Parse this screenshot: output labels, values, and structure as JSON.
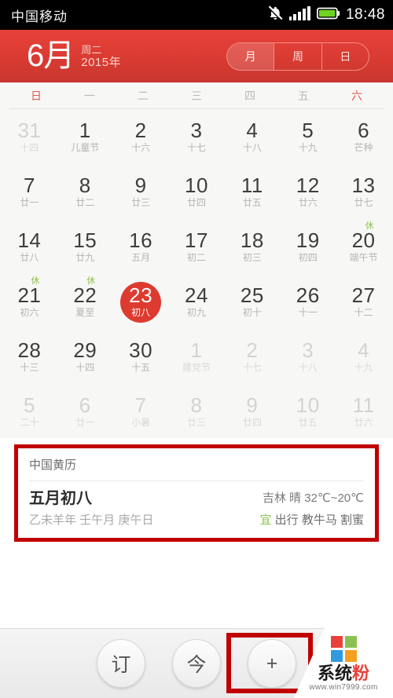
{
  "statusbar": {
    "carrier": "中国移动",
    "clock": "18:48",
    "icons": [
      "mute-bell-icon",
      "signal-bars-icon",
      "battery-icon"
    ]
  },
  "header": {
    "month": "6月",
    "weekday": "周二",
    "year": "2015年",
    "segments": [
      {
        "label": "月",
        "active": true
      },
      {
        "label": "周",
        "active": false
      },
      {
        "label": "日",
        "active": false
      }
    ],
    "accent_color": "#d93b32"
  },
  "calendar": {
    "weekdays": [
      "日",
      "一",
      "二",
      "三",
      "四",
      "五",
      "六"
    ],
    "weekend_color": "#e05a4e",
    "selected_color": "#dd3b30",
    "holiday_badge_color": "#8cc152",
    "weeks": [
      [
        {
          "num": "31",
          "sub": "十四",
          "out": true
        },
        {
          "num": "1",
          "sub": "儿童节",
          "out": false
        },
        {
          "num": "2",
          "sub": "十六",
          "out": false
        },
        {
          "num": "3",
          "sub": "十七",
          "out": false
        },
        {
          "num": "4",
          "sub": "十八",
          "out": false
        },
        {
          "num": "5",
          "sub": "十九",
          "out": false
        },
        {
          "num": "6",
          "sub": "芒种",
          "out": false
        }
      ],
      [
        {
          "num": "7",
          "sub": "廿一",
          "out": false
        },
        {
          "num": "8",
          "sub": "廿二",
          "out": false
        },
        {
          "num": "9",
          "sub": "廿三",
          "out": false
        },
        {
          "num": "10",
          "sub": "廿四",
          "out": false
        },
        {
          "num": "11",
          "sub": "廿五",
          "out": false
        },
        {
          "num": "12",
          "sub": "廿六",
          "out": false
        },
        {
          "num": "13",
          "sub": "廿七",
          "out": false
        }
      ],
      [
        {
          "num": "14",
          "sub": "廿八",
          "out": false
        },
        {
          "num": "15",
          "sub": "廿九",
          "out": false
        },
        {
          "num": "16",
          "sub": "五月",
          "out": false
        },
        {
          "num": "17",
          "sub": "初二",
          "out": false
        },
        {
          "num": "18",
          "sub": "初三",
          "out": false
        },
        {
          "num": "19",
          "sub": "初四",
          "out": false
        },
        {
          "num": "20",
          "sub": "端午节",
          "out": false,
          "badge": "休"
        }
      ],
      [
        {
          "num": "21",
          "sub": "初六",
          "out": false,
          "badge": "休"
        },
        {
          "num": "22",
          "sub": "夏至",
          "out": false,
          "badge": "休"
        },
        {
          "num": "23",
          "sub": "初八",
          "out": false,
          "selected": true
        },
        {
          "num": "24",
          "sub": "初九",
          "out": false
        },
        {
          "num": "25",
          "sub": "初十",
          "out": false
        },
        {
          "num": "26",
          "sub": "十一",
          "out": false
        },
        {
          "num": "27",
          "sub": "十二",
          "out": false
        }
      ],
      [
        {
          "num": "28",
          "sub": "十三",
          "out": false
        },
        {
          "num": "29",
          "sub": "十四",
          "out": false
        },
        {
          "num": "30",
          "sub": "十五",
          "out": false
        },
        {
          "num": "1",
          "sub": "建党节",
          "out": true
        },
        {
          "num": "2",
          "sub": "十七",
          "out": true
        },
        {
          "num": "3",
          "sub": "十八",
          "out": true
        },
        {
          "num": "4",
          "sub": "十九",
          "out": true
        }
      ],
      [
        {
          "num": "5",
          "sub": "二十",
          "out": true
        },
        {
          "num": "6",
          "sub": "廿一",
          "out": true
        },
        {
          "num": "7",
          "sub": "小暑",
          "out": true
        },
        {
          "num": "8",
          "sub": "廿三",
          "out": true
        },
        {
          "num": "9",
          "sub": "廿四",
          "out": true
        },
        {
          "num": "10",
          "sub": "廿五",
          "out": true
        },
        {
          "num": "11",
          "sub": "廿六",
          "out": true
        }
      ]
    ]
  },
  "info": {
    "header_label": "中国黄历",
    "lunar_date": "五月初八",
    "ganzhi": "乙未羊年 壬午月 庚午日",
    "weather": "吉林  晴  32℃~20℃",
    "yi_mark": "宜",
    "yi_items": "出行 教牛马 割蜜",
    "highlight_color": "#c00000"
  },
  "bottombar": {
    "buttons": [
      {
        "label": "订",
        "name": "subscribe-button"
      },
      {
        "label": "今",
        "name": "today-button"
      },
      {
        "label": "+",
        "name": "add-event-button",
        "highlighted": true
      }
    ],
    "highlight_color": "#c00000"
  },
  "watermark": {
    "text_part1": "系统",
    "text_part2": "粉",
    "url": "www.win7999.com",
    "logo_colors": [
      "#e8413a",
      "#8cc152",
      "#2f9ae0",
      "#f4a020"
    ]
  }
}
